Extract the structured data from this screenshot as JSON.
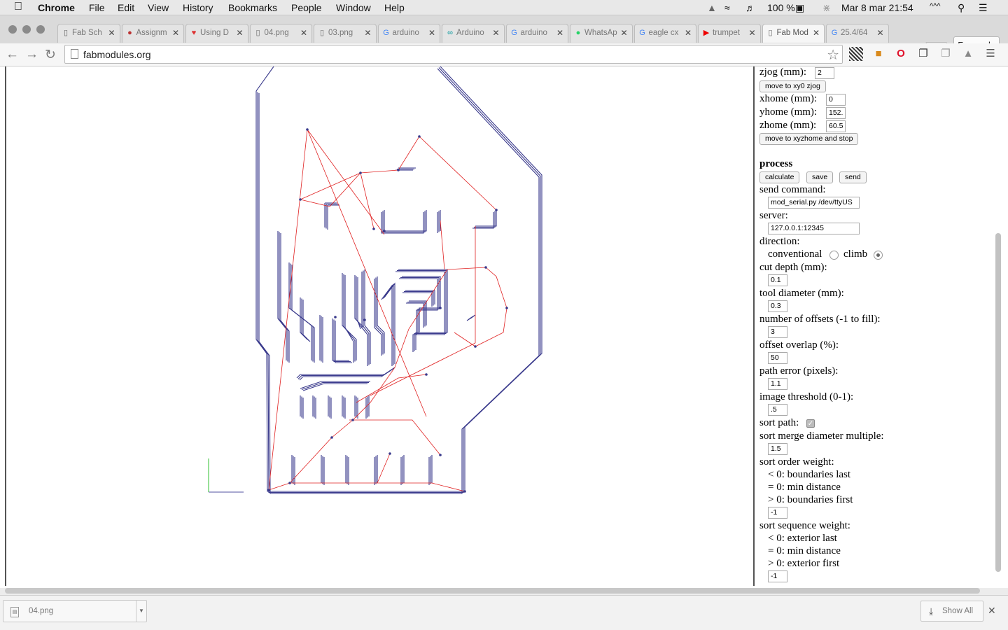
{
  "menubar": {
    "app": "Chrome",
    "items": [
      "File",
      "Edit",
      "View",
      "History",
      "Bookmarks",
      "People",
      "Window",
      "Help"
    ],
    "battery": "100 %",
    "clock": "Mar 8 mar  21:54",
    "extra": "^^^"
  },
  "tabs": [
    {
      "label": "Fab Sch",
      "icon": "page-icon",
      "active": false
    },
    {
      "label": "Assignm",
      "icon": "ball-icon",
      "active": false
    },
    {
      "label": "Using D",
      "icon": "heart-icon",
      "active": false
    },
    {
      "label": "04.png",
      "icon": "page-icon",
      "active": false
    },
    {
      "label": "03.png",
      "icon": "page-icon",
      "active": false
    },
    {
      "label": "arduino",
      "icon": "google-icon",
      "active": false
    },
    {
      "label": "Arduino",
      "icon": "arduino-icon",
      "active": false
    },
    {
      "label": "arduino",
      "icon": "google-icon",
      "active": false
    },
    {
      "label": "WhatsAp",
      "icon": "whatsapp-icon",
      "active": false
    },
    {
      "label": "eagle cx",
      "icon": "google-icon",
      "active": false
    },
    {
      "label": "trumpet",
      "icon": "youtube-icon",
      "active": false
    },
    {
      "label": "Fab Mod",
      "icon": "page-icon",
      "active": true
    },
    {
      "label": "25.4/64",
      "icon": "google-icon",
      "active": false
    }
  ],
  "profile": "Fernando",
  "address": "fabmodules.org",
  "colors": {
    "path_cut": "#3a3a8c",
    "path_move": "#e02020",
    "axis_x": "#5050a0",
    "axis_y": "#30c030"
  },
  "panel": {
    "zjog_label": "zjog (mm):",
    "zjog_value": "2",
    "move_xy0_button": "move to xy0 zjog",
    "xhome_label": "xhome (mm):",
    "xhome_value": "0",
    "yhome_label": "yhome (mm):",
    "yhome_value": "152.",
    "zhome_label": "zhome (mm):",
    "zhome_value": "60.5",
    "move_home_button": "move to xyzhome and stop",
    "process_heading": "process",
    "calculate_button": "calculate",
    "save_button": "save",
    "send_button": "send",
    "send_command_label": "send command:",
    "send_command_value": "mod_serial.py /dev/ttyUS",
    "server_label": "server:",
    "server_value": "127.0.0.1:12345",
    "direction_label": "direction:",
    "direction_conventional": "conventional",
    "direction_climb": "climb",
    "cut_depth_label": "cut depth (mm):",
    "cut_depth_value": "0.1",
    "tool_diameter_label": "tool diameter (mm):",
    "tool_diameter_value": "0.3",
    "offsets_label": "number of offsets (-1 to fill):",
    "offsets_value": "3",
    "offset_overlap_label": "offset overlap (%):",
    "offset_overlap_value": "50",
    "path_error_label": "path error (pixels):",
    "path_error_value": "1.1",
    "image_threshold_label": "image threshold (0-1):",
    "image_threshold_value": ".5",
    "sort_path_label": "sort path:",
    "sort_merge_label": "sort merge diameter multiple:",
    "sort_merge_value": "1.5",
    "sort_order_label": "sort order weight:",
    "sort_order_opt1": "< 0: boundaries last",
    "sort_order_opt2": "= 0: min distance",
    "sort_order_opt3": "> 0: boundaries first",
    "sort_order_value": "-1",
    "sort_sequence_label": "sort sequence weight:",
    "sort_sequence_opt1": "< 0: exterior last",
    "sort_sequence_opt2": "= 0: min distance",
    "sort_sequence_opt3": "> 0: exterior first",
    "sort_sequence_value": "-1"
  },
  "downloads": {
    "file": "04.png",
    "show_all": "Show All"
  }
}
